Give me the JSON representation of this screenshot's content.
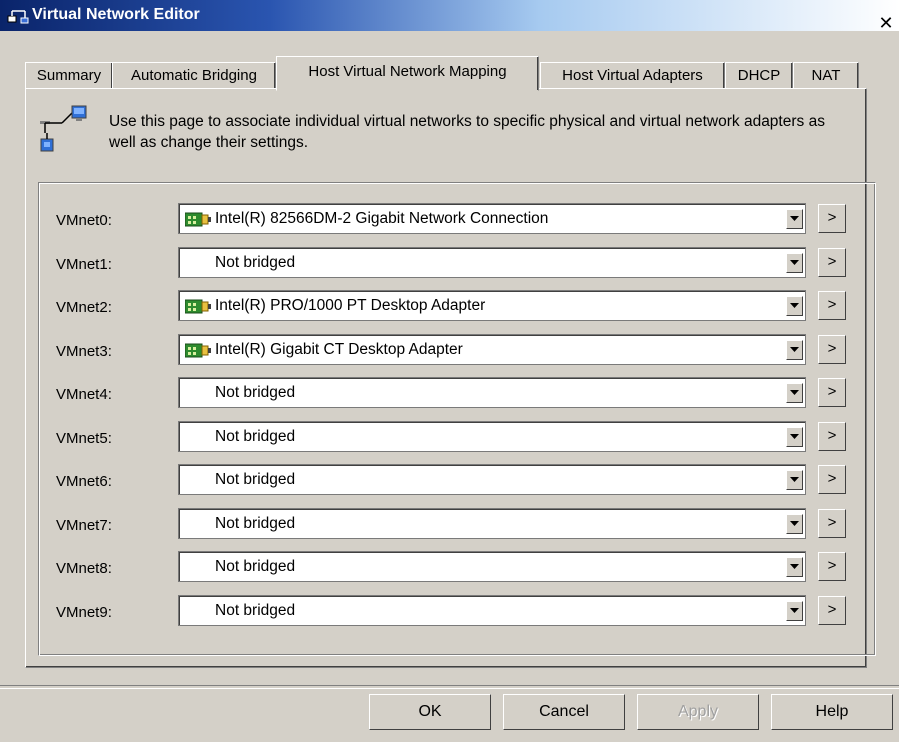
{
  "window": {
    "title": "Virtual Network Editor",
    "close_label": "✕"
  },
  "tabs": [
    {
      "label": "Summary",
      "active": false
    },
    {
      "label": "Automatic Bridging",
      "active": false
    },
    {
      "label": "Host Virtual Network Mapping",
      "active": true
    },
    {
      "label": "Host Virtual Adapters",
      "active": false
    },
    {
      "label": "DHCP",
      "active": false
    },
    {
      "label": "NAT",
      "active": false
    }
  ],
  "description": "Use this page to associate individual virtual networks to specific physical and virtual network adapters as well as change their settings.",
  "mappings": [
    {
      "label": "VMnet0:",
      "value": "Intel(R) 82566DM-2 Gigabit Network Connection",
      "has_icon": true,
      "button_label": ">"
    },
    {
      "label": "VMnet1:",
      "value": "Not bridged",
      "has_icon": false,
      "button_label": ">"
    },
    {
      "label": "VMnet2:",
      "value": "Intel(R) PRO/1000 PT Desktop Adapter",
      "has_icon": true,
      "button_label": ">"
    },
    {
      "label": "VMnet3:",
      "value": "Intel(R) Gigabit CT Desktop Adapter",
      "has_icon": true,
      "button_label": ">"
    },
    {
      "label": "VMnet4:",
      "value": "Not bridged",
      "has_icon": false,
      "button_label": ">"
    },
    {
      "label": "VMnet5:",
      "value": "Not bridged",
      "has_icon": false,
      "button_label": ">"
    },
    {
      "label": "VMnet6:",
      "value": "Not bridged",
      "has_icon": false,
      "button_label": ">"
    },
    {
      "label": "VMnet7:",
      "value": "Not bridged",
      "has_icon": false,
      "button_label": ">"
    },
    {
      "label": "VMnet8:",
      "value": "Not bridged",
      "has_icon": false,
      "button_label": ">"
    },
    {
      "label": "VMnet9:",
      "value": "Not bridged",
      "has_icon": false,
      "button_label": ">"
    }
  ],
  "buttons": {
    "ok": "OK",
    "cancel": "Cancel",
    "apply": "Apply",
    "help": "Help"
  },
  "icons": {
    "title": "network-editor-icon",
    "page": "network-mapping-icon",
    "adapter": "network-adapter-icon",
    "dropdown": "chevron-down-icon"
  },
  "colors": {
    "dialog_bg": "#d4d0c8",
    "titlebar_start": "#0a246a",
    "titlebar_end": "#a6caf0",
    "disabled_text": "#a0a0a0",
    "adapter_icon_green": "#2e8b2e"
  }
}
